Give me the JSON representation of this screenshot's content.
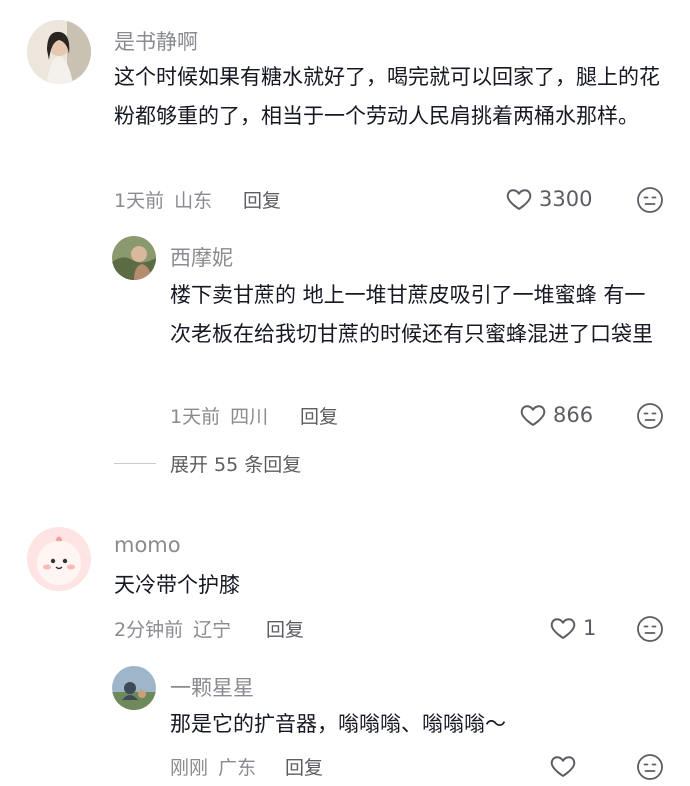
{
  "comments": [
    {
      "user": "是书静啊",
      "text": "这个时候如果有糖水就好了，喝完就可以回家了，腿上的花粉都够重的了，相当于一个劳动人民肩挑着两桶水那样。",
      "time": "1天前",
      "location": "山东",
      "reply_label": "回复",
      "likes": "3300",
      "replies": [
        {
          "user": "西摩妮",
          "text": "楼下卖甘蔗的  地上一堆甘蔗皮吸引了一堆蜜蜂  有一次老板在给我切甘蔗的时候还有只蜜蜂混进了口袋里",
          "time": "1天前",
          "location": "四川",
          "reply_label": "回复",
          "likes": "866"
        }
      ],
      "expand_label": "展开 55 条回复"
    },
    {
      "user": "momo",
      "text": "天冷带个护膝",
      "time": "2分钟前",
      "location": "辽宁",
      "reply_label": "回复",
      "likes": "1",
      "replies": [
        {
          "user": "一颗星星",
          "text": "那是它的扩音器，嗡嗡嗡、嗡嗡嗡～",
          "time": "刚刚",
          "location": "广东",
          "reply_label": "回复",
          "likes": ""
        }
      ]
    }
  ],
  "icons": {
    "like": "heart-outline-icon",
    "dislike": "meh-face-icon"
  },
  "colors": {
    "name": "#8a8b91",
    "text": "#161823",
    "meta": "#8a8b91",
    "action": "#5c5d63"
  }
}
